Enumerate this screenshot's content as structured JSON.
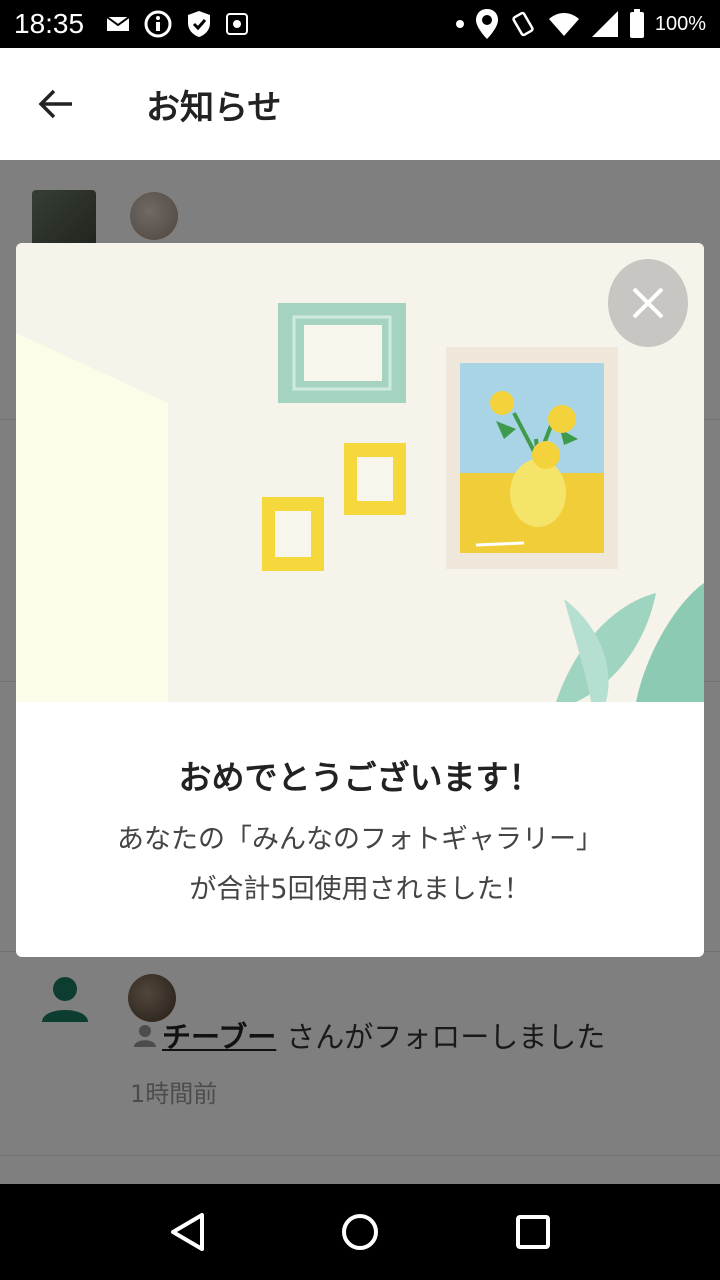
{
  "status_bar": {
    "time": "18:35",
    "battery": "100%",
    "icons": [
      "mail-icon",
      "info-icon",
      "shield-icon",
      "settings-icon",
      "dot-icon",
      "location-icon",
      "vibrate-icon",
      "wifi-icon",
      "signal-icon",
      "battery-icon"
    ]
  },
  "app_bar": {
    "back_icon": "arrow-back-icon",
    "title": "お知らせ"
  },
  "notifications": [
    {
      "user": "チーブー",
      "suffix": "さんがフォローしました",
      "time": "1時間前"
    }
  ],
  "modal": {
    "close_icon": "close-icon",
    "title": "おめでとうございます！",
    "line1": "あなたの「みんなのフォトギャラリー」",
    "line2": "が合計5回使用されました！"
  },
  "colors": {
    "accent": "#1a7a63",
    "overlay": "rgba(0,0,0,0.5)",
    "frame_mint": "#a4d4c0",
    "frame_yellow": "#f4d83c"
  },
  "nav_bar": {
    "icons": [
      "back-triangle-icon",
      "home-circle-icon",
      "recents-square-icon"
    ]
  }
}
